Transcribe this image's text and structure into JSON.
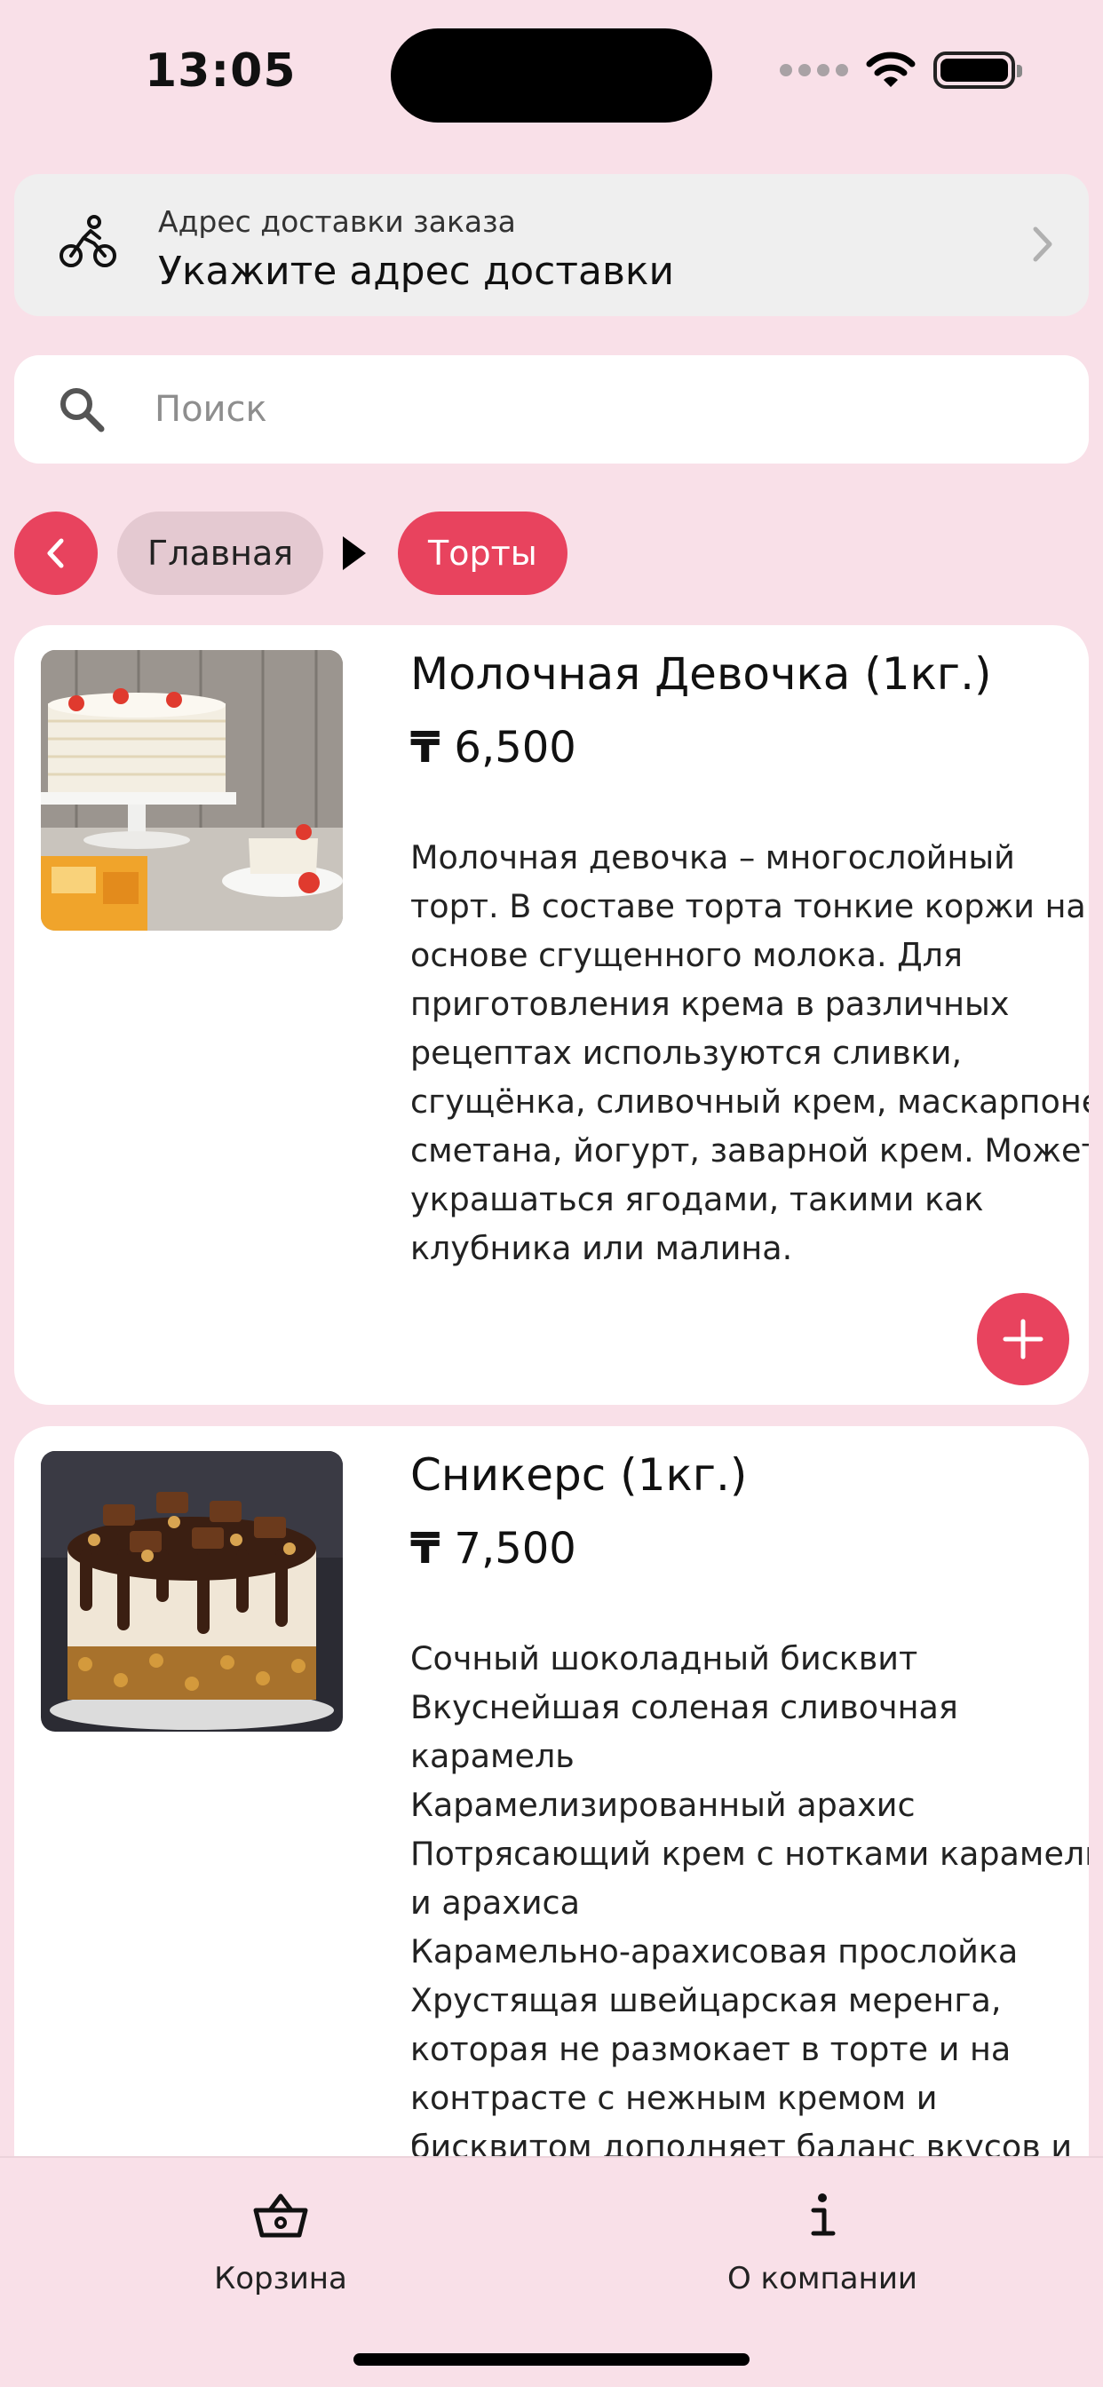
{
  "status_bar": {
    "time": "13:05"
  },
  "delivery": {
    "icon": "bicycle-icon",
    "label": "Адрес доставки заказа",
    "value": "Укажите адрес доставки"
  },
  "search": {
    "placeholder": "Поиск",
    "value": ""
  },
  "breadcrumb": {
    "home": "Главная",
    "current": "Торты"
  },
  "products": [
    {
      "name": "Молочная Девочка (1кг.)",
      "currency": "₸",
      "price": "6,500",
      "description_lines": [
        "Молочная девочка – многослойный",
        "торт. В составе торта тонкие коржи на",
        "основе сгущенного молока. Для",
        "приготовления крема в различных",
        "рецептах используются сливки,",
        "сгущёнка, сливочный крем, маскарпоне,",
        "сметана, йогурт, заварной крем. Может",
        "украшаться ягодами, такими как",
        "клубника или малина."
      ]
    },
    {
      "name": "Сникерс (1кг.)",
      "currency": "₸",
      "price": "7,500",
      "description_lines": [
        "Сочный шоколадный бисквит",
        "Вкуснейшая соленая сливочная",
        "карамель",
        "Карамелизированный арахис",
        "Потрясающий крем с нотками карамели",
        "и арахиса",
        "Карамельно-арахисовая прослойка",
        "Хрустящая швейцарская меренга,",
        "которая не размокает в торте и на",
        "контрасте с нежным кремом и",
        "бисквитом дополняет баланс вкусов и"
      ]
    }
  ],
  "tabbar": {
    "cart_label": "Корзина",
    "about_label": "О компании"
  },
  "colors": {
    "background": "#f9e0e8",
    "accent": "#e8435e",
    "chip": "#e4c9d1"
  }
}
